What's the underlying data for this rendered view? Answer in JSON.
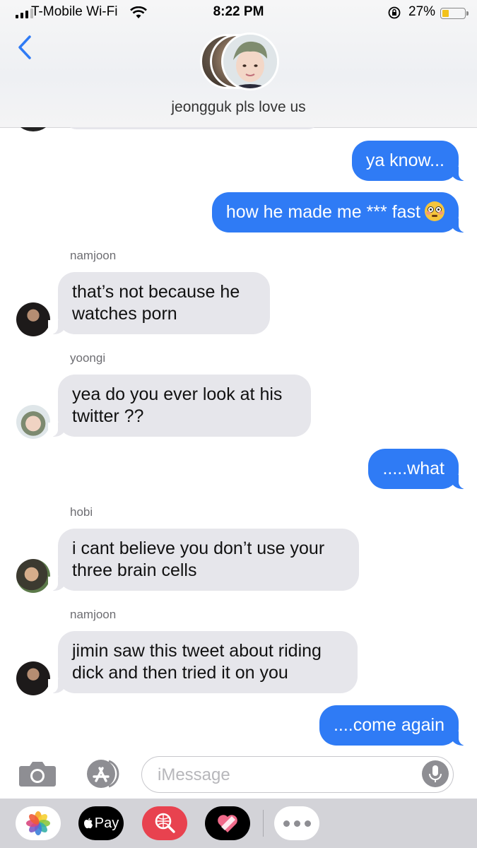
{
  "status_bar": {
    "carrier": "T-Mobile Wi-Fi",
    "time": "8:22 PM",
    "battery_percent": "27%",
    "battery_level": 0.27,
    "icons": [
      "signal-icon",
      "wifi-icon",
      "rotation-lock-icon",
      "battery-icon"
    ]
  },
  "header": {
    "group_name": "jeongguk pls love us",
    "back_icon": "chevron-left-icon"
  },
  "messages": [
    {
      "direction": "outgoing",
      "text": "ya know..."
    },
    {
      "direction": "outgoing",
      "text": "how he made me *** fast",
      "emoji": "flushed-face"
    },
    {
      "direction": "incoming",
      "sender": "namjoon",
      "text": "that’s not because he watches porn"
    },
    {
      "direction": "incoming",
      "sender": "yoongi",
      "text": "yea do you ever look at his twitter ??"
    },
    {
      "direction": "outgoing",
      "text": ".....what"
    },
    {
      "direction": "incoming",
      "sender": "hobi",
      "text": "i cant believe you don’t use your three brain cells"
    },
    {
      "direction": "incoming",
      "sender": "namjoon",
      "text": "jimin saw this tweet about riding dick and then tried it on you"
    },
    {
      "direction": "outgoing",
      "text": "....come again"
    }
  ],
  "input": {
    "placeholder": "iMessage",
    "icons": [
      "camera-icon",
      "app-store-icon",
      "microphone-icon"
    ]
  },
  "app_drawer": {
    "apple_pay_label": "Pay",
    "apps": [
      "photos-app",
      "apple-pay-app",
      "image-search-app",
      "heart-sticker-app",
      "more-apps"
    ]
  },
  "colors": {
    "outgoing_bubble": "#2f7bf5",
    "incoming_bubble": "#e6e6eb",
    "accent": "#2f7bf5"
  }
}
